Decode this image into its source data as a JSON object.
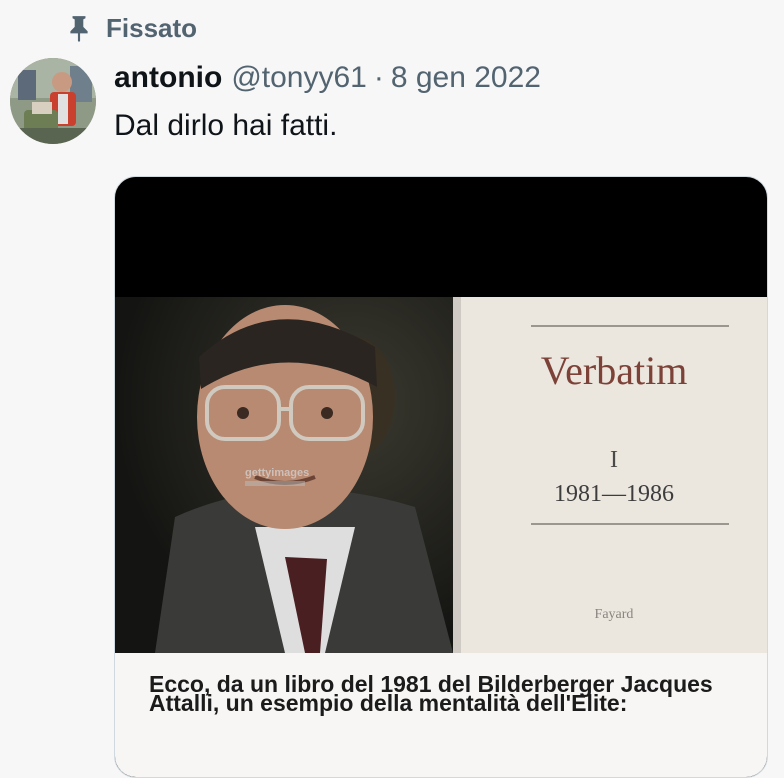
{
  "pinned": {
    "label": "Fissato",
    "icon": "pin-icon"
  },
  "tweet": {
    "author_name": "antonio",
    "handle": "@tonyy61",
    "separator": "·",
    "date": "8 gen 2022",
    "text": "Dal dirlo hai fatti."
  },
  "media": {
    "book": {
      "title": "Verbatim",
      "volume": "I",
      "years": "1981—1986",
      "publisher": "Fayard"
    },
    "watermark": "gettyimages",
    "caption": "Ecco, da un libro del 1981 del Bilderberger Jacques Attalli, un esempio della mentalità dell'Elite:"
  },
  "colors": {
    "background": "#f7f7f8",
    "secondary_text": "#536471",
    "primary_text": "#0f1419",
    "book_title": "#7c4238"
  }
}
